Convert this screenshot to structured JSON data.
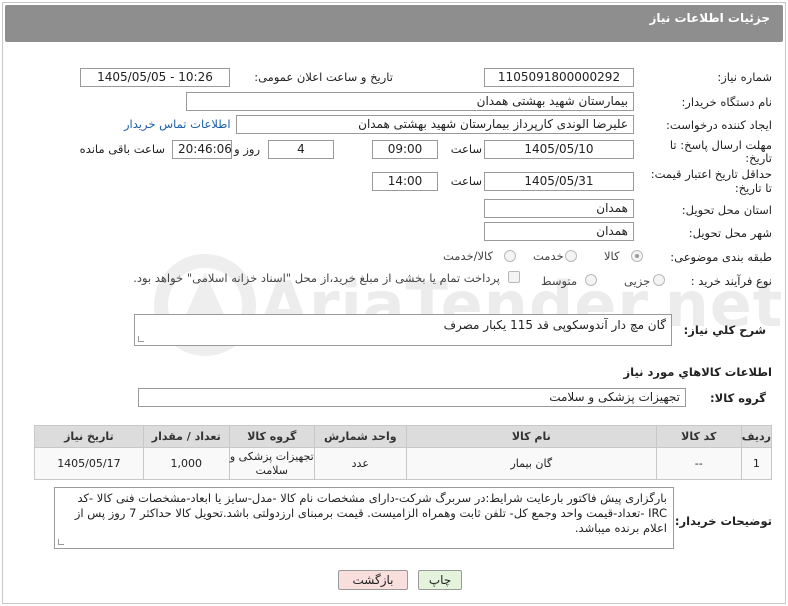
{
  "header": {
    "title": "جزئیات اطلاعات نیاز"
  },
  "watermark": {
    "text": "AriaTender.net"
  },
  "form": {
    "need_number_label": "شماره نیاز:",
    "need_number": "1105091800000292",
    "announce_label": "تاریخ و ساعت اعلان عمومی:",
    "announce_value": "1405/05/05 - 10:26",
    "buyer_org_label": "نام دستگاه خریدار:",
    "buyer_org": "بیمارستان شهید بهشتی همدان",
    "creator_label": "ایجاد کننده درخواست:",
    "creator": "علیرضا الوندی کارپرداز بیمارستان شهید بهشتی همدان",
    "contact_link": "اطلاعات تماس خریدار",
    "deadline_label_1": "مهلت ارسال پاسخ: تا",
    "deadline_label_2": "تاریخ:",
    "deadline_date": "1405/05/10",
    "time_label": "ساعت",
    "deadline_time": "09:00",
    "days_value": "4",
    "days_label": "روز و",
    "remaining_time": "20:46:06",
    "remaining_label": "ساعت باقی مانده",
    "validity_label_1": "حداقل تاریخ اعتبار قیمت:",
    "validity_label_2": "تا تاریخ:",
    "validity_date": "1405/05/31",
    "validity_time": "14:00",
    "province_label": "استان محل تحویل:",
    "province": "همدان",
    "city_label": "شهر محل تحویل:",
    "city": "همدان",
    "category_label": "طبقه بندی موضوعی:",
    "category_options": [
      "کالا",
      "خدمت",
      "کالا/خدمت"
    ],
    "category_selected": "کالا",
    "process_label": "نوع فرآیند خرید :",
    "process_options": [
      "جزیی",
      "متوسط"
    ],
    "payment_note": "پرداخت تمام یا بخشی از مبلغ خرید،از محل \"اسناد خزانه اسلامی\" خواهد بود."
  },
  "description": {
    "label": "شرح کلي نياز:",
    "value": "گان مچ دار آندوسکوپی قد 115 یکبار مصرف"
  },
  "goods_info": {
    "title": "اطلاعات کالاهاي مورد نياز",
    "group_label": "گروه کالا:",
    "group_value": "تجهیزات پزشکی و سلامت"
  },
  "table": {
    "headers": [
      "ردیف",
      "کد کالا",
      "نام کالا",
      "واحد شمارش",
      "گروه کالا",
      "تعداد / مقدار",
      "تاریخ نیاز"
    ],
    "rows": [
      {
        "row": "1",
        "code": "--",
        "name": "گان بیمار",
        "unit": "عدد",
        "group": "تجهیزات پزشکی و سلامت",
        "qty": "1,000",
        "date": "1405/05/17"
      }
    ]
  },
  "buyer_notes": {
    "label": "توضیحات خریدار:",
    "value": "بارگزاری پیش فاکتور بارعایت شرایط:در سربرگ شرکت-دارای مشخصات نام کالا -مدل-سایز یا ابعاد-مشخصات فنی کالا -کد IRC -تعداد-قیمت واحد وجمع کل- تلفن ثابت وهمراه الزامیست. قیمت برمبنای ارزدولتی باشد.تحویل کالا حداکثر 7 روز پس از اعلام برنده میباشد."
  },
  "buttons": {
    "print": "چاپ",
    "back": "بازگشت"
  },
  "colors": {
    "header": "#8e8e8e",
    "link": "#1a5fa8",
    "back_button": "#f9dede",
    "print_button": "#e6f3dc"
  }
}
